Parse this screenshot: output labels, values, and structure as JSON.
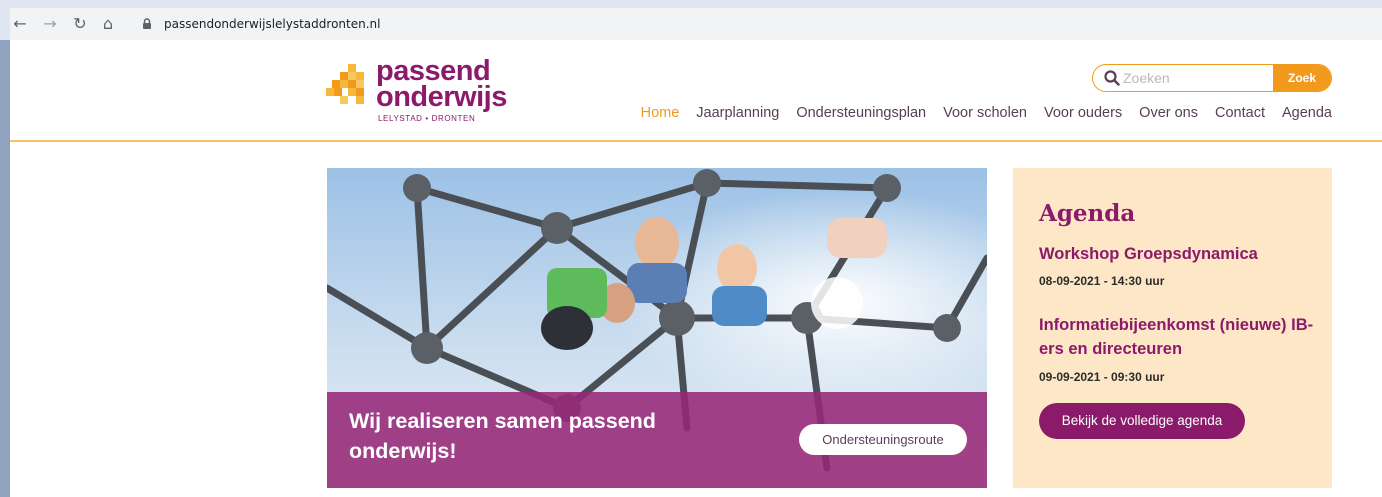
{
  "browser": {
    "url": "passendonderwijslelystaddronten.nl",
    "back_icon": "arrow-left-icon",
    "forward_icon": "arrow-right-icon",
    "reload_icon": "reload-icon",
    "home_icon": "home-icon",
    "lock_icon": "lock-icon"
  },
  "logo": {
    "line1": "passend",
    "line2": "onderwijs",
    "subtitle": "LELYSTAD • DRONTEN"
  },
  "search": {
    "placeholder": "Zoeken",
    "button_label": "Zoek"
  },
  "nav": {
    "items": [
      {
        "label": "Home",
        "active": true
      },
      {
        "label": "Jaarplanning",
        "active": false
      },
      {
        "label": "Ondersteuningsplan",
        "active": false
      },
      {
        "label": "Voor scholen",
        "active": false
      },
      {
        "label": "Voor ouders",
        "active": false
      },
      {
        "label": "Over ons",
        "active": false
      },
      {
        "label": "Contact",
        "active": false
      },
      {
        "label": "Agenda",
        "active": false
      }
    ]
  },
  "hero": {
    "title": "Wij realiseren samen passend onderwijs!",
    "button_label": "Ondersteuningsroute"
  },
  "agenda": {
    "title": "Agenda",
    "events": [
      {
        "title": "Workshop Groepsdynamica",
        "date": "08-09-2021 - 14:30 uur"
      },
      {
        "title": "Informatiebijeenkomst (nieuwe) IB-ers en directeuren",
        "date": "09-09-2021 - 09:30 uur"
      }
    ],
    "button_label": "Bekijk de volledige agenda"
  },
  "colors": {
    "brand_purple": "#8b1a6b",
    "accent_orange": "#f29a1b",
    "agenda_bg": "#fde7c6"
  }
}
